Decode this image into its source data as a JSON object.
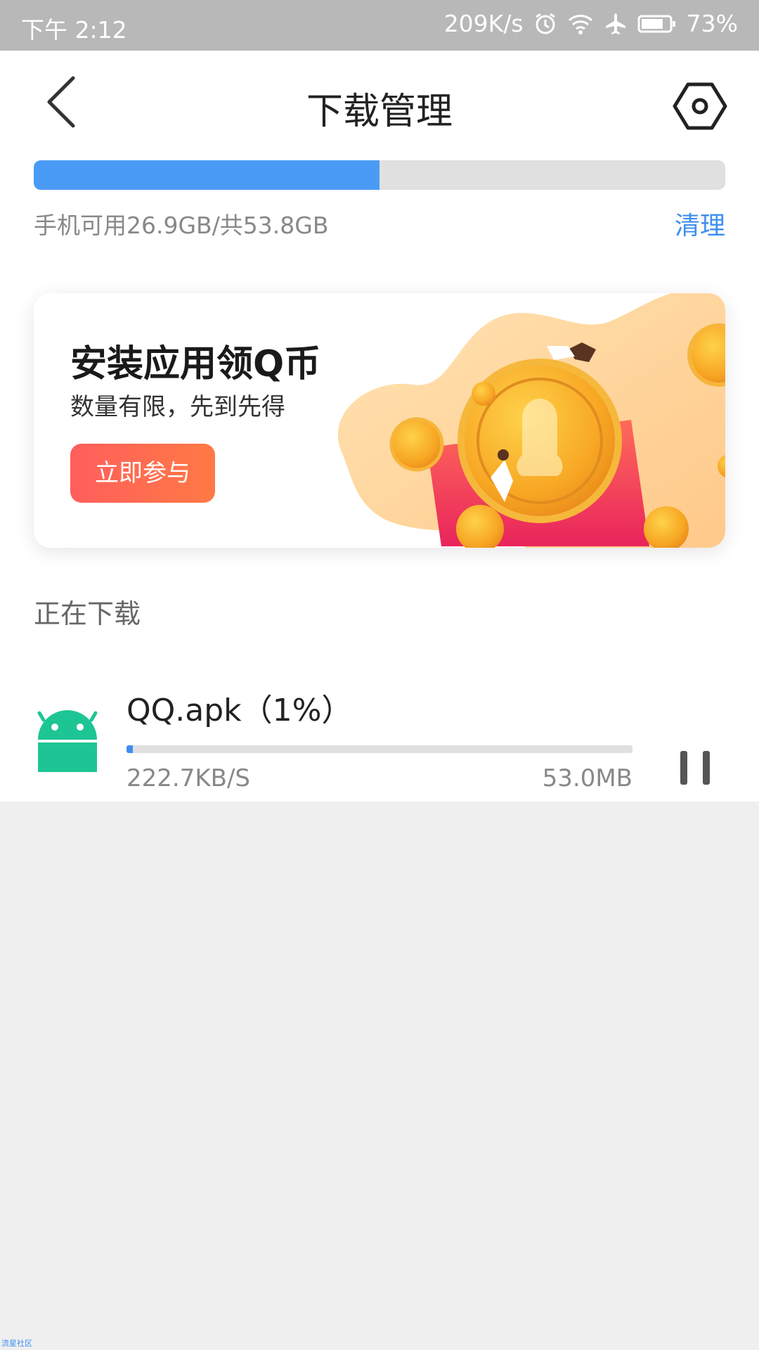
{
  "status_bar": {
    "time": "下午 2:12",
    "net_speed": "209K/s",
    "battery_percent": "73%",
    "icons": [
      "alarm-icon",
      "wifi-icon",
      "airplane-icon",
      "battery-icon"
    ]
  },
  "header": {
    "title": "下载管理",
    "back_icon": "chevron-left-icon",
    "settings_icon": "hexagon-settings-icon"
  },
  "storage": {
    "text": "手机可用26.9GB/共53.8GB",
    "used_fraction": 0.5,
    "clean_label": "清理",
    "bar_color": "#4a9bf5"
  },
  "banner": {
    "title": "安装应用领Q币",
    "subtitle": "数量有限，先到先得",
    "button_label": "立即参与"
  },
  "downloading": {
    "section_title": "正在下载",
    "items": [
      {
        "name": "QQ.apk（1%）",
        "progress": 0.01,
        "speed": "222.7KB/S",
        "size": "53.0MB",
        "icon": "android-icon",
        "icon_color": "#1ec594"
      }
    ]
  },
  "watermark": "流星社区"
}
